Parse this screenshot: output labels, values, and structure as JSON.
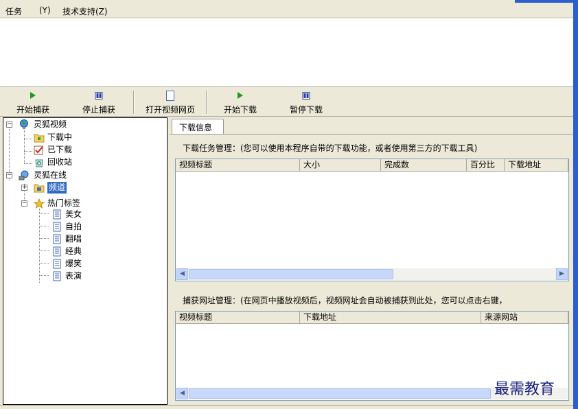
{
  "menu": {
    "items": [
      {
        "label": "任务"
      },
      {
        "label": "(Y)"
      },
      {
        "label": "技术支持(Z)"
      }
    ]
  },
  "toolbar": {
    "start_capture": "开始捕获",
    "stop_capture": "停止捕获",
    "open_video_page": "打开视频网页",
    "start_download": "开始下载",
    "pause_download": "暂停下载"
  },
  "tree": {
    "video": "灵狐视频",
    "downloading": "下载中",
    "downloaded": "已下载",
    "recycle": "回收站",
    "online": "灵狐在线",
    "channels": "频道",
    "hot_tags": "热门标签",
    "tags": [
      "美女",
      "自拍",
      "翻唱",
      "经典",
      "爆笑",
      "表演"
    ]
  },
  "tabs": {
    "download_info": "下载信息"
  },
  "download_section": {
    "title": "下载任务管理：(您可以使用本程序自带的下载功能，或者使用第三方的下载工具)",
    "columns": [
      "视频标题",
      "大小",
      "完成数",
      "百分比",
      "下载地址"
    ]
  },
  "capture_section": {
    "title": "捕获网址管理：(在网页中播放视频后，视频网址会自动被捕获到此处，您可以点击右键，",
    "columns": [
      "视频标题",
      "下载地址",
      "来源网站"
    ]
  },
  "watermark": "最需教育",
  "colors": {
    "accent": "#316ac5",
    "frame": "#2b5fd0",
    "background": "#ece9d8"
  }
}
